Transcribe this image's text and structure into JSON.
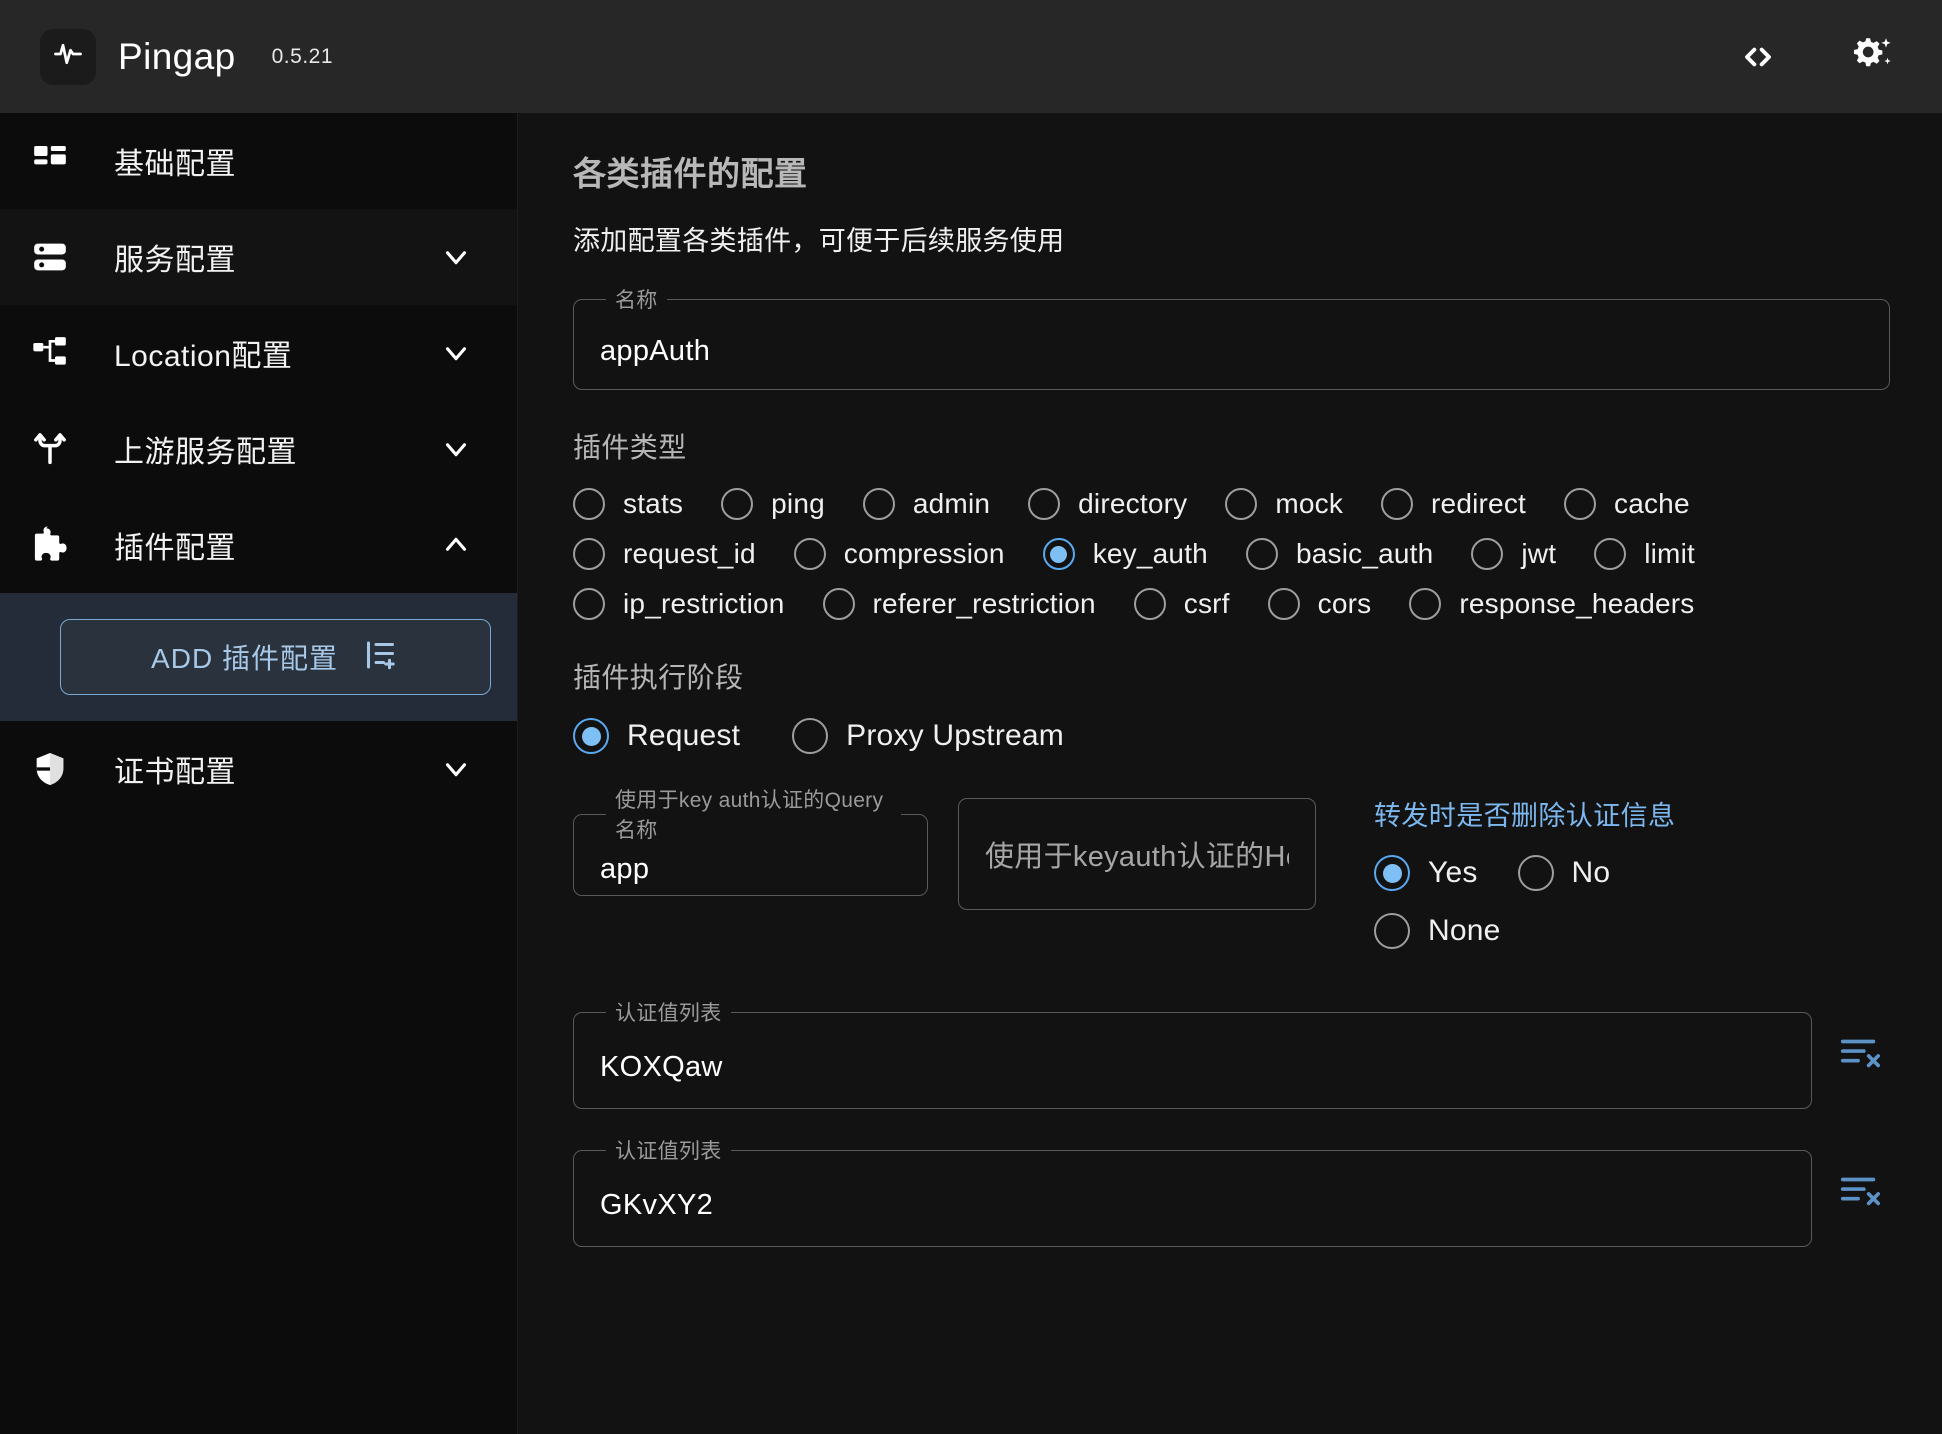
{
  "header": {
    "logo_icon": "activity-pulse-icon",
    "title": "Pingap",
    "version": "0.5.21",
    "code_icon": "code-brackets-icon",
    "settings_icon": "gear-sparkle-icon"
  },
  "sidebar": {
    "items": [
      {
        "label": "基础配置",
        "icon": "dashboard-layout-icon",
        "has_chevron": false
      },
      {
        "label": "服务配置",
        "icon": "server-icon",
        "has_chevron": true,
        "chevron": "down"
      },
      {
        "label": "Location配置",
        "icon": "network-tree-icon",
        "has_chevron": true,
        "chevron": "down"
      },
      {
        "label": "上游服务配置",
        "icon": "git-fork-icon",
        "has_chevron": true,
        "chevron": "down"
      },
      {
        "label": "插件配置",
        "icon": "puzzle-piece-icon",
        "has_chevron": true,
        "chevron": "up"
      },
      {
        "label": "证书配置",
        "icon": "shield-half-icon",
        "has_chevron": true,
        "chevron": "down"
      }
    ],
    "add_button": {
      "label": "ADD 插件配置",
      "icon": "list-plus-icon",
      "border_color": "#7ba7d0",
      "text_color": "#a8c8e8"
    }
  },
  "main": {
    "title": "各类插件的配置",
    "subtitle": "添加配置各类插件，可便于后续服务使用",
    "name_field": {
      "legend": "名称",
      "value": "appAuth",
      "placeholder": ""
    },
    "plugin_type": {
      "label": "插件类型",
      "selected": "key_auth",
      "rows": [
        [
          "stats",
          "ping",
          "admin",
          "directory",
          "mock",
          "redirect",
          "cache"
        ],
        [
          "request_id",
          "compression",
          "key_auth",
          "basic_auth",
          "jwt",
          "limit"
        ],
        [
          "ip_restriction",
          "referer_restriction",
          "csrf",
          "cors",
          "response_headers"
        ]
      ]
    },
    "plugin_step": {
      "label": "插件执行阶段",
      "selected": "Request",
      "options": [
        "Request",
        "Proxy Upstream"
      ]
    },
    "query_field": {
      "legend": "使用于key auth认证的Query名称",
      "value": "app"
    },
    "header_field": {
      "placeholder": "使用于keyauth认证的He…",
      "value": ""
    },
    "remove_auth": {
      "label": "转发时是否删除认证信息",
      "label_color": "#7cb8ef",
      "selected": "Yes",
      "options": [
        "Yes",
        "No",
        "None"
      ]
    },
    "auth_values": [
      {
        "legend": "认证值列表",
        "value": "KOXQaw",
        "action_icon": "list-remove-icon"
      },
      {
        "legend": "认证值列表",
        "value": "GKvXY2",
        "action_icon": "list-remove-icon"
      }
    ]
  },
  "colors": {
    "accent": "#7ec0f5",
    "header_bg": "#272727",
    "sidebar_bg": "#0c0c0c",
    "main_bg": "#121212",
    "sub_panel_bg": "#232c38"
  }
}
